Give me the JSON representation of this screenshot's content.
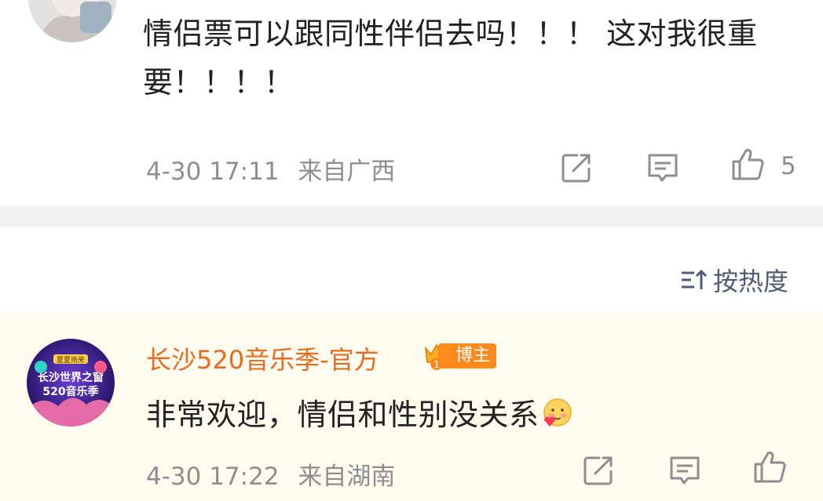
{
  "comment_1": {
    "text": "情侣票可以跟同性伴侣去吗！！！ 这对我很重要！！！！",
    "timestamp": "4-30 17:11",
    "location": "来自广西",
    "like_count": "5",
    "icons": [
      "share-icon",
      "comment-icon",
      "like-icon"
    ]
  },
  "sort": {
    "label": "按热度"
  },
  "comment_2": {
    "username": "长沙520音乐季-官方",
    "badge": "博主",
    "badge_level": "1",
    "avatar_text": {
      "line1": "夏夏雨来",
      "line2": "长沙世界之窗",
      "line3": "520音乐季"
    },
    "text": "非常欢迎，情侣和性别没关系",
    "timestamp": "4-30 17:22",
    "location": "来自湖南",
    "icons": [
      "share-icon",
      "comment-icon",
      "like-icon"
    ]
  },
  "colors": {
    "username": "#e86b1f",
    "badge_bg": "#ff8a1c",
    "meta_text": "#8e8e8e",
    "sort_text": "#505b78",
    "highlight_bg": "#fffbef"
  }
}
